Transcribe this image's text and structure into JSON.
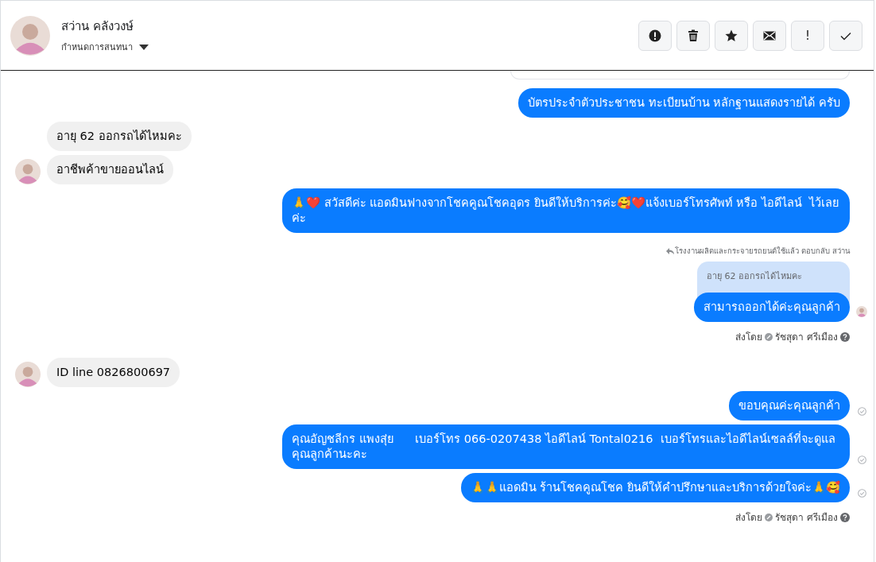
{
  "header": {
    "name": "สว่าน คลังวงษ์",
    "subtitle": "กำหนดการสนทนา",
    "buttons": [
      {
        "kind": "alert"
      },
      {
        "kind": "trash"
      },
      {
        "kind": "star"
      },
      {
        "kind": "mail"
      },
      {
        "kind": "text",
        "label": "!"
      },
      {
        "kind": "check"
      }
    ]
  },
  "messages": [
    {
      "kind": "outgoing",
      "text": "บัตรประจำตัวประชาชน ทะเบียนบ้าน หลักฐานแสดงรายได้ ครับ"
    },
    {
      "kind": "incoming",
      "avatar": false,
      "text": "อายุ 62 ออกรถได้ไหมคะ"
    },
    {
      "kind": "incoming",
      "avatar": true,
      "text": "อาชีพค้าขายออนไลน์"
    },
    {
      "kind": "outgoing",
      "text": "🙏❤️ สวัสดีค่ะ แอดมินฟางจากโชคคูณโชคอุดร ยินดีให้บริการค่ะ🥰❤️แจ้งเบอร์โทรศัพท์ หรือ ไอดีไลน์  ไว้เลยค่ะ"
    },
    {
      "kind": "outgoing",
      "reply_note": "โรงงานผลิตและกระจายรถยนต์ใช้แล้ว ตอบกลับ สว่าน",
      "quoted": "อายุ 62 ออกรถได้ไหมคะ",
      "text": "สามารถออกได้ค่ะคุณลูกค้า",
      "seen": true,
      "sent_by": {
        "label": "ส่งโดย",
        "name": "รัชสุดา ศรีเมือง"
      }
    },
    {
      "kind": "incoming",
      "avatar": true,
      "text": "ID line 0826800697"
    },
    {
      "kind": "outgoing",
      "text": "ขอบคุณค่ะคุณลูกค้า",
      "delivered": true
    },
    {
      "kind": "outgoing",
      "text": "คุณอัญชลีกร แพงสุ่ย      เบอร์โทร 066-0207438 ไอดีไลน์ Tontal0216  เบอร์โทรและไอดีไลน์เซลล์ที่จะดูแลคุณลูกค้านะคะ",
      "delivered": true
    },
    {
      "kind": "outgoing",
      "text": "🙏🙏แอดมิน ร้านโชคคูณโชค ยินดีให้คำปรึกษาและบริการด้วยใจค่ะ🙏🥰",
      "delivered": true,
      "sent_by": {
        "label": "ส่งโดย",
        "name": "รัชสุดา ศรีเมือง"
      }
    }
  ]
}
